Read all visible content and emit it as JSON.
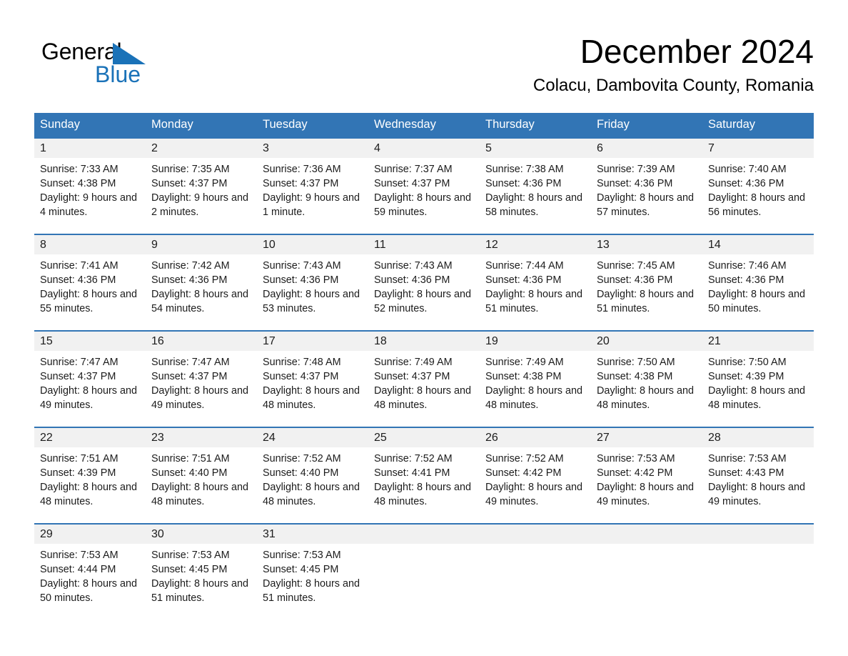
{
  "brand": {
    "name_dark": "General",
    "name_light": "Blue",
    "accent_color": "#1a72b8"
  },
  "header": {
    "title": "December 2024",
    "subtitle": "Colacu, Dambovita County, Romania"
  },
  "theme": {
    "header_blue": "#3275b5",
    "daynum_band": "#f1f1f1",
    "text": "#1c1c1c"
  },
  "weekdays": [
    "Sunday",
    "Monday",
    "Tuesday",
    "Wednesday",
    "Thursday",
    "Friday",
    "Saturday"
  ],
  "weeks": [
    [
      {
        "day": "1",
        "sunrise": "Sunrise: 7:33 AM",
        "sunset": "Sunset: 4:38 PM",
        "daylight": "Daylight: 9 hours and 4 minutes."
      },
      {
        "day": "2",
        "sunrise": "Sunrise: 7:35 AM",
        "sunset": "Sunset: 4:37 PM",
        "daylight": "Daylight: 9 hours and 2 minutes."
      },
      {
        "day": "3",
        "sunrise": "Sunrise: 7:36 AM",
        "sunset": "Sunset: 4:37 PM",
        "daylight": "Daylight: 9 hours and 1 minute."
      },
      {
        "day": "4",
        "sunrise": "Sunrise: 7:37 AM",
        "sunset": "Sunset: 4:37 PM",
        "daylight": "Daylight: 8 hours and 59 minutes."
      },
      {
        "day": "5",
        "sunrise": "Sunrise: 7:38 AM",
        "sunset": "Sunset: 4:36 PM",
        "daylight": "Daylight: 8 hours and 58 minutes."
      },
      {
        "day": "6",
        "sunrise": "Sunrise: 7:39 AM",
        "sunset": "Sunset: 4:36 PM",
        "daylight": "Daylight: 8 hours and 57 minutes."
      },
      {
        "day": "7",
        "sunrise": "Sunrise: 7:40 AM",
        "sunset": "Sunset: 4:36 PM",
        "daylight": "Daylight: 8 hours and 56 minutes."
      }
    ],
    [
      {
        "day": "8",
        "sunrise": "Sunrise: 7:41 AM",
        "sunset": "Sunset: 4:36 PM",
        "daylight": "Daylight: 8 hours and 55 minutes."
      },
      {
        "day": "9",
        "sunrise": "Sunrise: 7:42 AM",
        "sunset": "Sunset: 4:36 PM",
        "daylight": "Daylight: 8 hours and 54 minutes."
      },
      {
        "day": "10",
        "sunrise": "Sunrise: 7:43 AM",
        "sunset": "Sunset: 4:36 PM",
        "daylight": "Daylight: 8 hours and 53 minutes."
      },
      {
        "day": "11",
        "sunrise": "Sunrise: 7:43 AM",
        "sunset": "Sunset: 4:36 PM",
        "daylight": "Daylight: 8 hours and 52 minutes."
      },
      {
        "day": "12",
        "sunrise": "Sunrise: 7:44 AM",
        "sunset": "Sunset: 4:36 PM",
        "daylight": "Daylight: 8 hours and 51 minutes."
      },
      {
        "day": "13",
        "sunrise": "Sunrise: 7:45 AM",
        "sunset": "Sunset: 4:36 PM",
        "daylight": "Daylight: 8 hours and 51 minutes."
      },
      {
        "day": "14",
        "sunrise": "Sunrise: 7:46 AM",
        "sunset": "Sunset: 4:36 PM",
        "daylight": "Daylight: 8 hours and 50 minutes."
      }
    ],
    [
      {
        "day": "15",
        "sunrise": "Sunrise: 7:47 AM",
        "sunset": "Sunset: 4:37 PM",
        "daylight": "Daylight: 8 hours and 49 minutes."
      },
      {
        "day": "16",
        "sunrise": "Sunrise: 7:47 AM",
        "sunset": "Sunset: 4:37 PM",
        "daylight": "Daylight: 8 hours and 49 minutes."
      },
      {
        "day": "17",
        "sunrise": "Sunrise: 7:48 AM",
        "sunset": "Sunset: 4:37 PM",
        "daylight": "Daylight: 8 hours and 48 minutes."
      },
      {
        "day": "18",
        "sunrise": "Sunrise: 7:49 AM",
        "sunset": "Sunset: 4:37 PM",
        "daylight": "Daylight: 8 hours and 48 minutes."
      },
      {
        "day": "19",
        "sunrise": "Sunrise: 7:49 AM",
        "sunset": "Sunset: 4:38 PM",
        "daylight": "Daylight: 8 hours and 48 minutes."
      },
      {
        "day": "20",
        "sunrise": "Sunrise: 7:50 AM",
        "sunset": "Sunset: 4:38 PM",
        "daylight": "Daylight: 8 hours and 48 minutes."
      },
      {
        "day": "21",
        "sunrise": "Sunrise: 7:50 AM",
        "sunset": "Sunset: 4:39 PM",
        "daylight": "Daylight: 8 hours and 48 minutes."
      }
    ],
    [
      {
        "day": "22",
        "sunrise": "Sunrise: 7:51 AM",
        "sunset": "Sunset: 4:39 PM",
        "daylight": "Daylight: 8 hours and 48 minutes."
      },
      {
        "day": "23",
        "sunrise": "Sunrise: 7:51 AM",
        "sunset": "Sunset: 4:40 PM",
        "daylight": "Daylight: 8 hours and 48 minutes."
      },
      {
        "day": "24",
        "sunrise": "Sunrise: 7:52 AM",
        "sunset": "Sunset: 4:40 PM",
        "daylight": "Daylight: 8 hours and 48 minutes."
      },
      {
        "day": "25",
        "sunrise": "Sunrise: 7:52 AM",
        "sunset": "Sunset: 4:41 PM",
        "daylight": "Daylight: 8 hours and 48 minutes."
      },
      {
        "day": "26",
        "sunrise": "Sunrise: 7:52 AM",
        "sunset": "Sunset: 4:42 PM",
        "daylight": "Daylight: 8 hours and 49 minutes."
      },
      {
        "day": "27",
        "sunrise": "Sunrise: 7:53 AM",
        "sunset": "Sunset: 4:42 PM",
        "daylight": "Daylight: 8 hours and 49 minutes."
      },
      {
        "day": "28",
        "sunrise": "Sunrise: 7:53 AM",
        "sunset": "Sunset: 4:43 PM",
        "daylight": "Daylight: 8 hours and 49 minutes."
      }
    ],
    [
      {
        "day": "29",
        "sunrise": "Sunrise: 7:53 AM",
        "sunset": "Sunset: 4:44 PM",
        "daylight": "Daylight: 8 hours and 50 minutes."
      },
      {
        "day": "30",
        "sunrise": "Sunrise: 7:53 AM",
        "sunset": "Sunset: 4:45 PM",
        "daylight": "Daylight: 8 hours and 51 minutes."
      },
      {
        "day": "31",
        "sunrise": "Sunrise: 7:53 AM",
        "sunset": "Sunset: 4:45 PM",
        "daylight": "Daylight: 8 hours and 51 minutes."
      },
      {
        "day": "",
        "sunrise": "",
        "sunset": "",
        "daylight": ""
      },
      {
        "day": "",
        "sunrise": "",
        "sunset": "",
        "daylight": ""
      },
      {
        "day": "",
        "sunrise": "",
        "sunset": "",
        "daylight": ""
      },
      {
        "day": "",
        "sunrise": "",
        "sunset": "",
        "daylight": ""
      }
    ]
  ]
}
